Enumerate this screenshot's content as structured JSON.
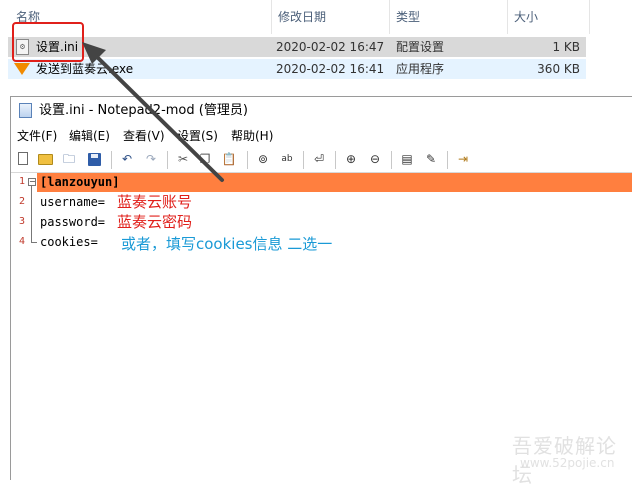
{
  "explorer": {
    "columns": [
      "名称",
      "修改日期",
      "类型",
      "大小"
    ],
    "files": [
      {
        "name": "设置.ini",
        "date": "2020-02-02 16:47",
        "type": "配置设置",
        "size": "1 KB"
      },
      {
        "name": "发送到蓝奏云.exe",
        "date": "2020-02-02 16:41",
        "type": "应用程序",
        "size": "360 KB"
      }
    ]
  },
  "notepad": {
    "title": "设置.ini - Notepad2-mod (管理员)",
    "menu": [
      "文件(F)",
      "编辑(E)",
      "查看(V)",
      "设置(S)",
      "帮助(H)"
    ],
    "lines": [
      {
        "num": "1",
        "text": "[lanzouyun]"
      },
      {
        "num": "2",
        "text": "username="
      },
      {
        "num": "3",
        "text": "password="
      },
      {
        "num": "4",
        "text": "cookies="
      }
    ]
  },
  "annotations": {
    "username_note": "蓝奏云账号",
    "password_note": "蓝奏云密码",
    "cookies_note": "或者，填写cookies信息  二选一"
  },
  "watermark": {
    "line1": "吾爱破解论坛",
    "line2": "www.52pojie.cn"
  },
  "colors": {
    "highlight": "#ff7f3f",
    "annotation_red": "#e0201b",
    "annotation_blue": "#1a9ad6",
    "callout_box": "#e0201b"
  }
}
